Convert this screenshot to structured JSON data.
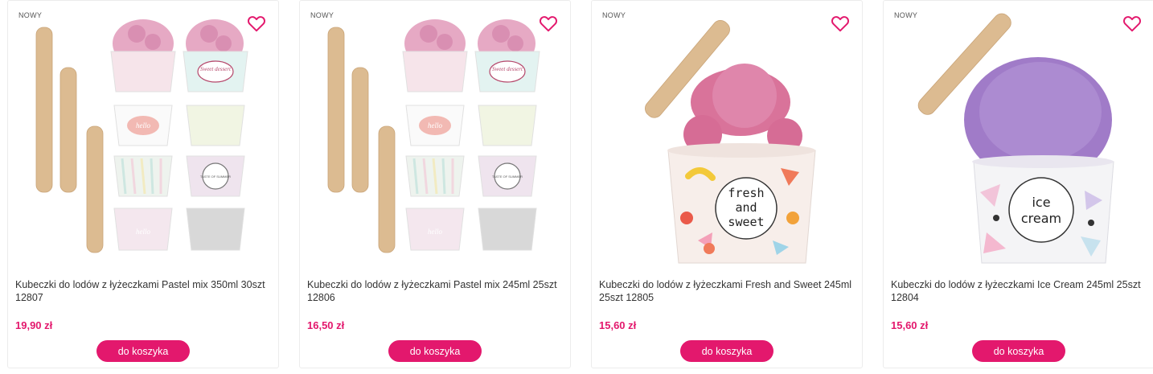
{
  "products": [
    {
      "badge": "NOWY",
      "title": "Kubeczki do lodów z łyżeczkami Pastel mix 350ml 30szt 12807",
      "price": "19,90 zł",
      "cart_label": "do koszyka",
      "image": "pastel-mix-cups-with-spoons",
      "cup_texts": [
        "Sweet dessert",
        "hello",
        "TASTE OF SUMMER",
        "hello"
      ]
    },
    {
      "badge": "NOWY",
      "title": "Kubeczki do lodów z łyżeczkami Pastel mix 245ml 25szt 12806",
      "price": "16,50 zł",
      "cart_label": "do koszyka",
      "image": "pastel-mix-cups-with-spoons",
      "cup_texts": [
        "Sweet dessert",
        "hello",
        "TASTE OF SUMMER",
        "hello"
      ]
    },
    {
      "badge": "NOWY",
      "title": "Kubeczki do lodów z łyżeczkami Fresh and Sweet 245ml 25szt 12805",
      "price": "15,60 zł",
      "cart_label": "do koszyka",
      "image": "fresh-and-sweet-cup",
      "cup_texts": [
        "fresh",
        "and",
        "sweet"
      ]
    },
    {
      "badge": "NOWY",
      "title": "Kubeczki do lodów z łyżeczkami Ice Cream 245ml 25szt 12804",
      "price": "15,60 zł",
      "cart_label": "do koszyka",
      "image": "ice-cream-cup",
      "cup_texts": [
        "ice",
        "cream"
      ]
    }
  ],
  "colors": {
    "accent": "#e3186d",
    "heart": "#e3186d",
    "pink_ice_cream": "#d9739a",
    "purple_ice_cream": "#a07bc8",
    "wood": "#dbb98e"
  },
  "icons": {
    "favorite": "heart-outline-icon"
  }
}
